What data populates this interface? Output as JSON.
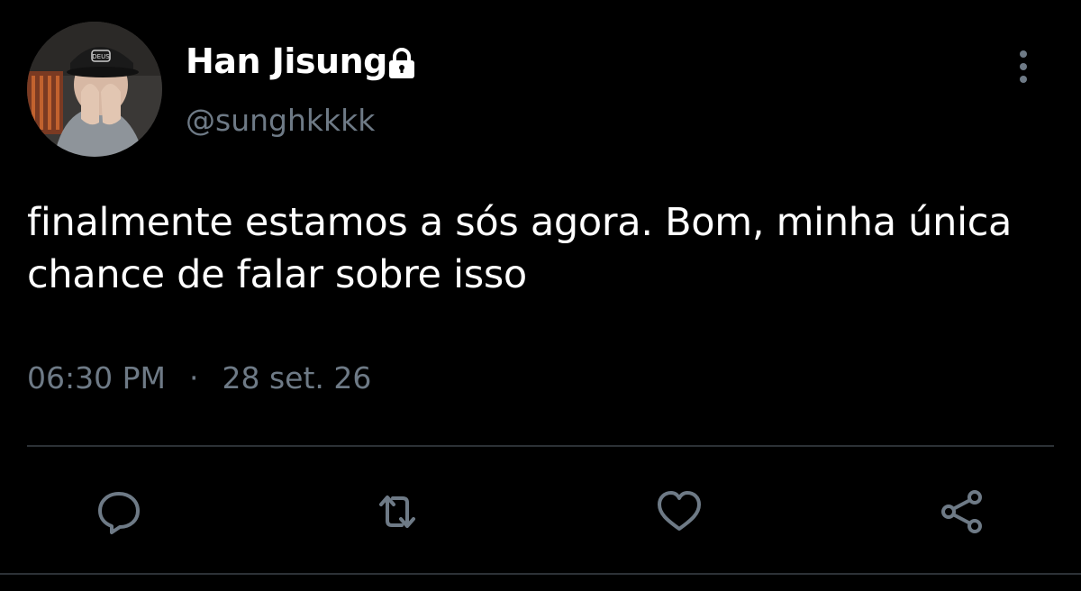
{
  "tweet": {
    "display_name": "Han Jisung",
    "handle": "@sunghkkkk",
    "text": "finalmente estamos a sós agora. Bom, minha única chance de falar sobre isso",
    "time": "06:30 PM",
    "separator": "·",
    "date": "28 set. 26",
    "avatar_cap_text": "DEUS",
    "protected_icon": "lock-icon"
  },
  "actions": [
    {
      "icon": "reply-icon"
    },
    {
      "icon": "retweet-icon"
    },
    {
      "icon": "like-icon"
    },
    {
      "icon": "share-icon"
    }
  ],
  "colors": {
    "background": "#000000",
    "text": "#ffffff",
    "secondary": "#6e7a86",
    "divider": "#2c3136"
  }
}
